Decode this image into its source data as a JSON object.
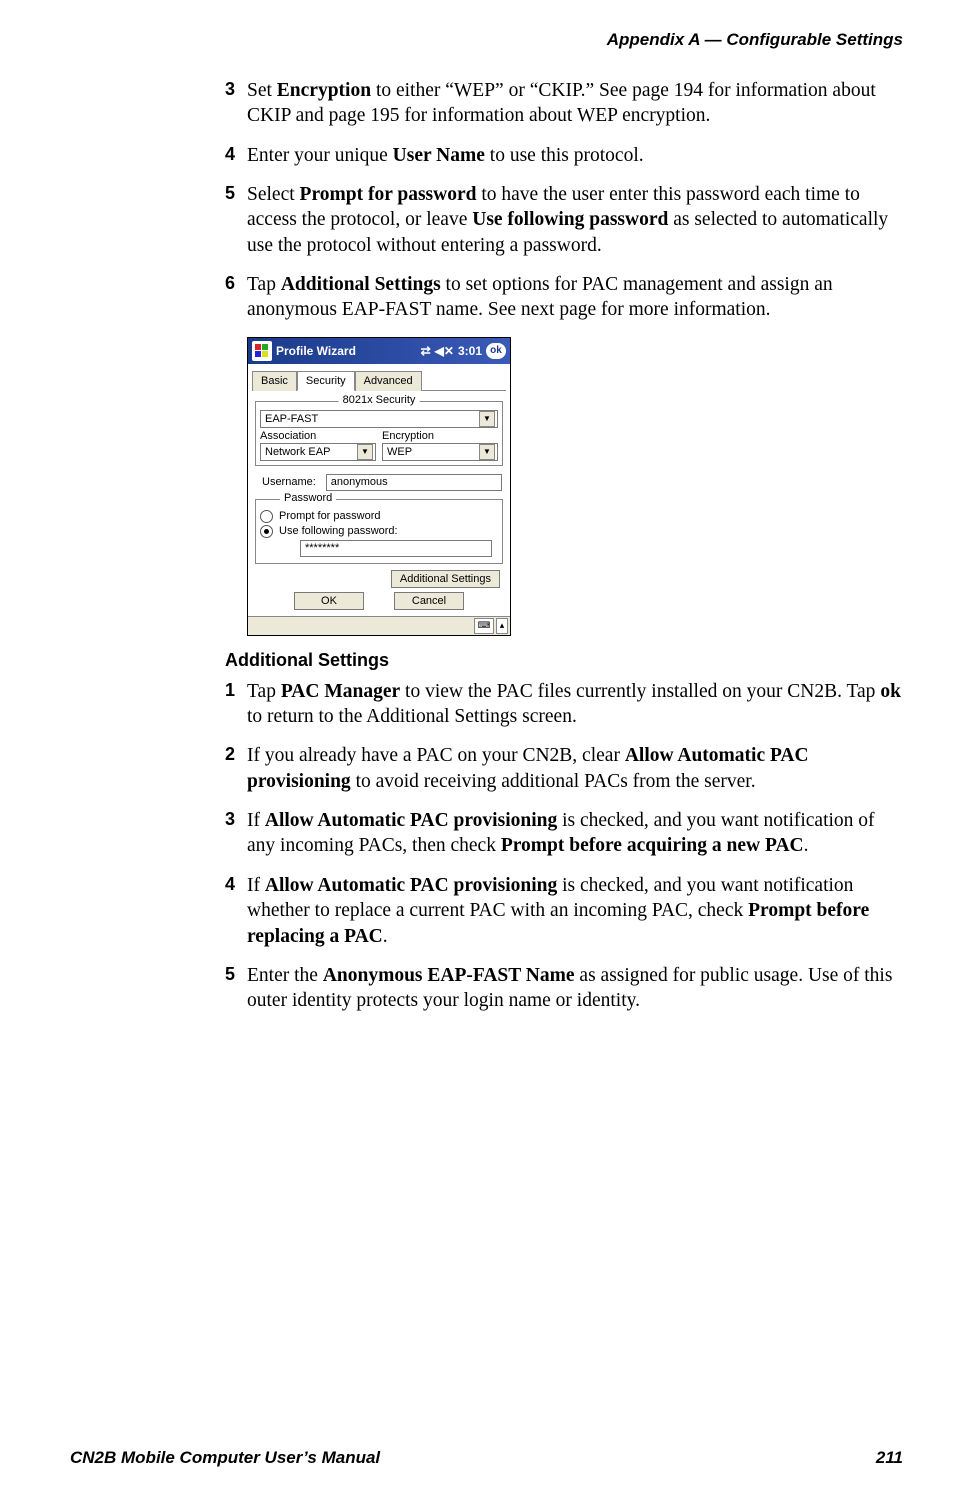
{
  "header": "Appendix A —  Configurable Settings",
  "steps_top": [
    {
      "n": "3",
      "html": "Set <b>Encryption</b> to either “WEP” or “CKIP.” See page 194 for information about CKIP and page 195 for information about WEP encryption."
    },
    {
      "n": "4",
      "html": "Enter your unique <b>User Name</b> to use this protocol."
    },
    {
      "n": "5",
      "html": "Select <b>Prompt for password</b> to have the user enter this password each time to access the protocol, or leave <b>Use following password</b> as selected to automatically use the protocol without entering a password."
    },
    {
      "n": "6",
      "html": "Tap <b>Additional Settings</b> to set options for PAC management and assign an anonymous EAP-FAST name. See next page for more information."
    }
  ],
  "pda": {
    "title": "Profile Wizard",
    "time": "3:01",
    "ok": "ok",
    "tabs": [
      "Basic",
      "Security",
      "Advanced"
    ],
    "active_tab": 1,
    "group_label": "8021x Security",
    "eap": "EAP-FAST",
    "assoc_label": "Association",
    "assoc_value": "Network EAP",
    "enc_label": "Encryption",
    "enc_value": "WEP",
    "username_label": "Username:",
    "username_value": "anonymous",
    "pw_group": "Password",
    "radio_prompt": "Prompt for password",
    "radio_use": "Use following password:",
    "pw_value": "********",
    "addl_btn": "Additional Settings",
    "ok_btn": "OK",
    "cancel_btn": "Cancel"
  },
  "subhead": "Additional Settings",
  "steps_bottom": [
    {
      "n": "1",
      "html": "Tap <b>PAC Manager</b> to view the PAC files currently installed on your CN2B. Tap <b>ok</b> to return to the Additional Settings screen."
    },
    {
      "n": "2",
      "html": "If you already have a PAC on your CN2B, clear <b>Allow Automatic PAC provisioning</b> to avoid receiving additional PACs from the server."
    },
    {
      "n": "3",
      "html": "If <b>Allow Automatic PAC provisioning</b> is checked, and you want notification of any incoming PACs, then check <b>Prompt before acquiring a new PAC</b>."
    },
    {
      "n": "4",
      "html": "If <b>Allow Automatic PAC provisioning</b> is checked, and you want notification whether to replace a current PAC with an incoming PAC, check <b>Prompt before replacing a PAC</b>."
    },
    {
      "n": "5",
      "html": "Enter the <b>Anonymous EAP-FAST Name</b> as assigned for public usage. Use of this outer identity protects your login name or identity."
    }
  ],
  "footer_left": "CN2B Mobile Computer User’s Manual",
  "footer_right": "211"
}
